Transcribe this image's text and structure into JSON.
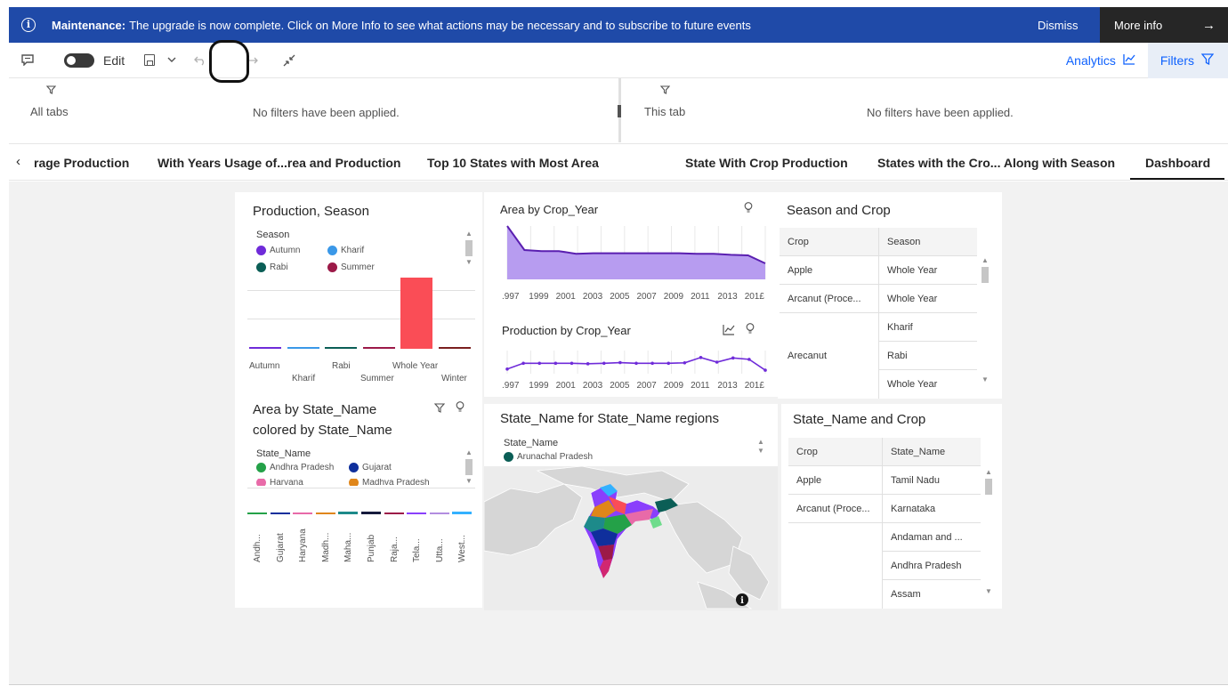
{
  "banner": {
    "label_bold": "Maintenance:",
    "message": "The upgrade is now complete. Click on More Info to see what actions may be necessary and to subscribe to future events",
    "dismiss": "Dismiss",
    "more_info": "More info",
    "icon": "info-icon",
    "color": "#1f4aa8"
  },
  "toolbar": {
    "edit_label": "Edit",
    "analytics_label": "Analytics",
    "filters_label": "Filters",
    "accent": "#0f62fe"
  },
  "filterbar": {
    "left_scope": "All tabs",
    "left_status": "No filters have been applied.",
    "right_scope": "This tab",
    "right_status": "No filters have been applied."
  },
  "tabs": [
    {
      "label": "rage Production"
    },
    {
      "label": "With Years Usage of...rea and Production"
    },
    {
      "label": "Top 10  States with Most Area"
    },
    {
      "label": "State With Crop Production"
    },
    {
      "label": "States with the Cro... Along with Season"
    },
    {
      "label": "Dashboard",
      "active": true
    }
  ],
  "widgets": {
    "production_season": {
      "title": "Production, Season",
      "legend_title": "Season",
      "legend": [
        {
          "label": "Autumn",
          "color": "#6f2bd9"
        },
        {
          "label": "Kharif",
          "color": "#3a98e8"
        },
        {
          "label": "Rabi",
          "color": "#0b5e56"
        },
        {
          "label": "Summer",
          "color": "#9c1a48"
        }
      ],
      "categories_top": [
        "Autumn",
        "Rabi",
        "Whole Year"
      ],
      "categories_bottom": [
        "Kharif",
        "Summer",
        "Winter"
      ],
      "chart_data": {
        "type": "bar",
        "categories": [
          "Autumn",
          "Kharif",
          "Rabi",
          "Summer",
          "Whole Year",
          "Winter"
        ],
        "values": [
          0.5,
          1.5,
          1,
          0.5,
          100,
          2.5
        ],
        "colors": [
          "#6f2bd9",
          "#3a98e8",
          "#0b5e56",
          "#9c1a48",
          "#fa4d56",
          "#7a1f1f"
        ]
      }
    },
    "area_by_year": {
      "title": "Area by Crop_Year",
      "x_labels": [
        ".997",
        "1999",
        "2001",
        "2003",
        "2005",
        "2007",
        "2009",
        "2011",
        "2013",
        "201£"
      ],
      "chart_data": {
        "type": "area",
        "values": [
          100,
          55,
          53,
          53,
          48,
          49,
          49,
          49,
          49,
          49,
          49,
          48,
          48,
          46,
          45,
          30
        ]
      }
    },
    "production_by_year": {
      "title": "Production by Crop_Year",
      "x_labels": [
        ".997",
        "1999",
        "2001",
        "2003",
        "2005",
        "2007",
        "2009",
        "2011",
        "2013",
        "201£"
      ],
      "chart_data": {
        "type": "line",
        "values": [
          20,
          45,
          45,
          45,
          45,
          43,
          45,
          48,
          45,
          45,
          45,
          47,
          70,
          50,
          68,
          62,
          15
        ]
      }
    },
    "season_crop": {
      "title": "Season and Crop",
      "headers": [
        "Crop",
        "Season"
      ],
      "rows": [
        [
          "Apple",
          "Whole Year"
        ],
        [
          "Arcanut (Proce...",
          "Whole Year"
        ],
        [
          "",
          "Kharif"
        ],
        [
          "Arecanut",
          "Rabi"
        ],
        [
          "",
          "Whole Year"
        ]
      ]
    },
    "area_by_state": {
      "title_line1": "Area by State_Name",
      "title_line2": "colored by State_Name",
      "legend_title": "State_Name",
      "legend": [
        {
          "label": "Andhra Pradesh",
          "color": "#24a148"
        },
        {
          "label": "Gujarat",
          "color": "#0f2f9c"
        },
        {
          "label": "Harvana",
          "color": "#e86aa8"
        },
        {
          "label": "Madhva Pradesh",
          "color": "#e0861a"
        }
      ],
      "categories": [
        "Andh...",
        "Gujarat",
        "Haryana",
        "Madh...",
        "Maha...",
        "Punjab",
        "Raja...",
        "Tela...",
        "Utta...",
        "West..."
      ],
      "chart_data": {
        "type": "bar",
        "values": [
          1,
          1,
          1,
          1,
          1.5,
          1.5,
          1,
          1,
          1,
          1.5
        ],
        "colors": [
          "#24a148",
          "#0f2f9c",
          "#e86aa8",
          "#e0861a",
          "#1d8a8a",
          "#161b3d",
          "#9c1a48",
          "#8a3ffc",
          "#b28de0",
          "#33b1ff"
        ]
      }
    },
    "state_map": {
      "title": "State_Name for State_Name regions",
      "legend_title": "State_Name",
      "legend": [
        {
          "label": "Arunachal Pradesh",
          "color": "#0b5e56"
        }
      ]
    },
    "state_crop": {
      "title": "State_Name and Crop",
      "headers": [
        "Crop",
        "State_Name"
      ],
      "rows": [
        [
          "Apple",
          "Tamil Nadu"
        ],
        [
          "Arcanut (Proce...",
          "Karnataka"
        ],
        [
          "",
          "Andaman and ..."
        ],
        [
          "",
          "Andhra Pradesh"
        ],
        [
          "",
          "Assam"
        ]
      ]
    }
  }
}
